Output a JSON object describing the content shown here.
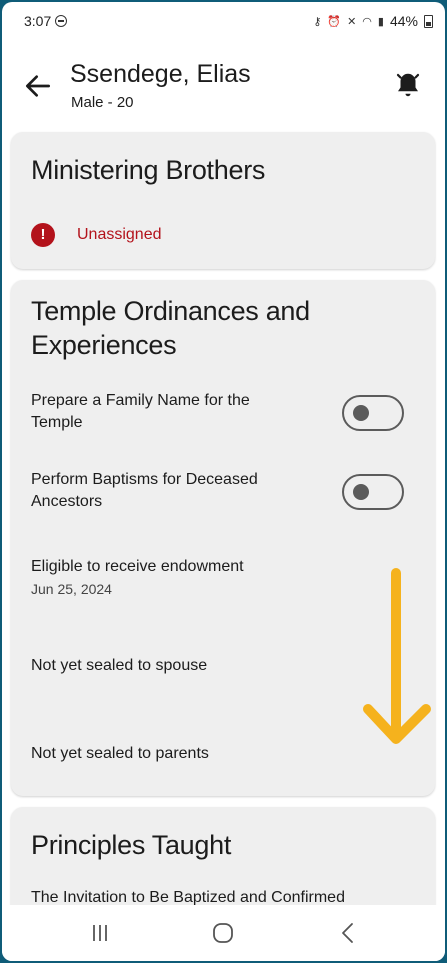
{
  "status_bar": {
    "time": "3:07",
    "battery": "44%",
    "icons": [
      "dnd-icon",
      "key-icon",
      "alarm-icon",
      "mute-icon",
      "wifi-icon",
      "signal-icon",
      "battery-icon"
    ]
  },
  "header": {
    "title": "Ssendege, Elias",
    "subtitle": "Male - 20",
    "back_icon": "arrow-left-icon",
    "notify_icon": "bell-icon"
  },
  "ministering": {
    "title": "Ministering Brothers",
    "status": "Unassigned",
    "status_icon": "error-icon",
    "status_color": "#b3121b"
  },
  "temple": {
    "title_line1": "Temple Ordinances and",
    "title_line2": "Experiences",
    "toggles": [
      {
        "line1": "Prepare a Family Name for the",
        "line2": "Temple",
        "on": false
      },
      {
        "line1": "Perform Baptisms for Deceased",
        "line2": "Ancestors",
        "on": false
      }
    ],
    "endowment_label": "Eligible to receive endowment",
    "endowment_date": "Jun 25, 2024",
    "spouse_label": "Not yet sealed to spouse",
    "parents_label": "Not yet sealed to parents"
  },
  "principles": {
    "title": "Principles Taught",
    "first_item": "The Invitation to Be Baptized and Confirmed"
  },
  "annotation": {
    "arrow_color": "#f5b21d",
    "direction": "down"
  },
  "colors": {
    "card_bg": "#efefef",
    "frame": "#0f5c78",
    "error": "#b3121b"
  }
}
